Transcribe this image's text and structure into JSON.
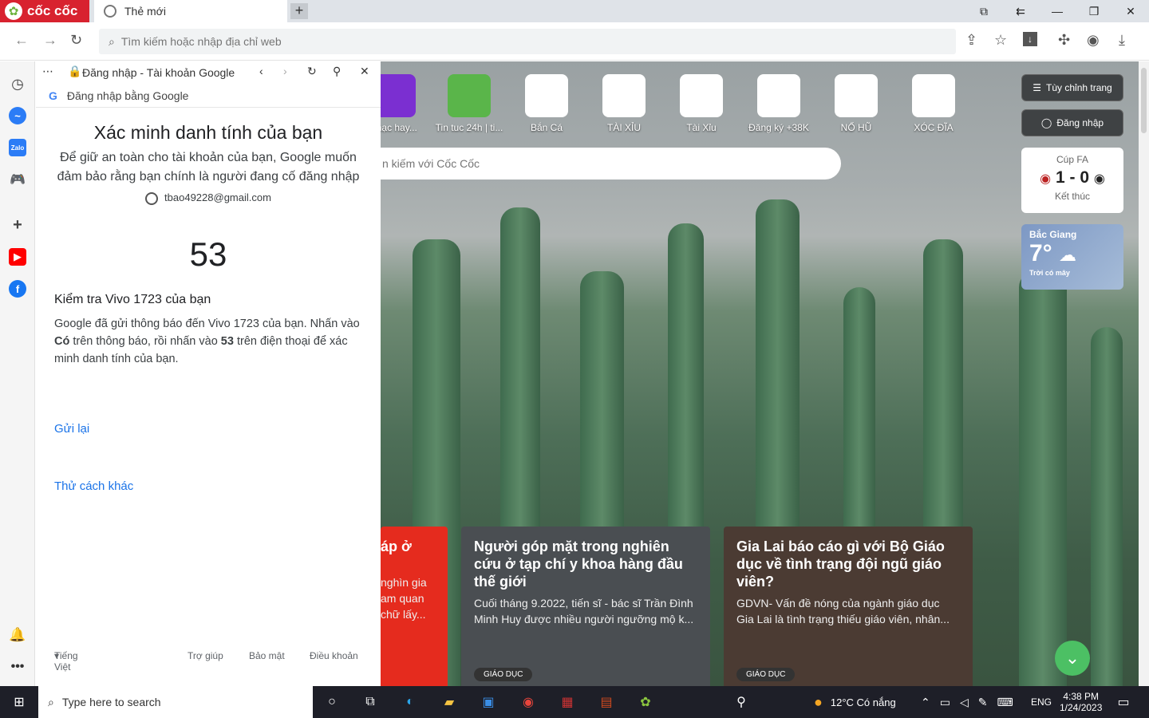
{
  "browser": {
    "brand": "cốc cốc",
    "tab_title": "Thẻ mới",
    "address_placeholder": "Tìm kiếm hoặc nhập địa chỉ web"
  },
  "panel": {
    "page_title": "Đăng nhập - Tài khoản Google",
    "google_line": "Đăng nhập bằng Google",
    "heading": "Xác minh danh tính của bạn",
    "subtitle": "Để giữ an toàn cho tài khoản của bạn, Google muốn đảm bảo rằng bạn chính là người đang cố đăng nhập",
    "email": "tbao49228@gmail.com",
    "code": "53",
    "check_heading": "Kiểm tra Vivo 1723 của bạn",
    "body_1": "Google đã gửi thông báo đến Vivo 1723 của bạn. Nhấn vào ",
    "body_bold_1": "Có",
    "body_2": " trên thông báo, rồi nhấn vào ",
    "body_bold_2": "53",
    "body_3": " trên điện thoại để xác minh danh tính của bạn.",
    "resend": "Gửi lại",
    "try_other": "Thử cách khác",
    "language": "Tiếng Việt",
    "help": "Trợ giúp",
    "privacy": "Bảo mật",
    "terms": "Điều khoản"
  },
  "newtab": {
    "tiles": [
      {
        "label": "nhạc hay..."
      },
      {
        "label": "Tin tuc 24h | ti..."
      },
      {
        "label": "Bắn Cá"
      },
      {
        "label": "TÀI XỈU"
      },
      {
        "label": "Tài Xỉu"
      },
      {
        "label": "Đăng ký +38K"
      },
      {
        "label": "NỔ HŨ"
      },
      {
        "label": "XÓC ĐĨA"
      }
    ],
    "search_placeholder": "n kiếm với Cốc Cốc",
    "customize": "Tùy chỉnh trang",
    "login": "Đăng nhập",
    "score": {
      "league": "Cúp FA",
      "result": "1 - 0",
      "status": "Kết thúc"
    },
    "weather": {
      "city": "Bắc Giang",
      "temp": "7°",
      "desc": "Trời có mây"
    },
    "cards": [
      {
        "title": "áp ở",
        "desc": "nghìn gia\nam quan\nchữ lấy...",
        "color": "#e52b1e"
      },
      {
        "title": "Người góp mặt trong nghiên cứu ở tạp chí y khoa hàng đầu thế giới",
        "desc": "Cuối tháng 9.2022, tiến sĩ - bác sĩ Trần Đình Minh Huy được nhiều người ngưỡng mộ k...",
        "tag": "GIÁO DỤC",
        "color": "#4a4e52"
      },
      {
        "title": "Gia Lai báo cáo gì với Bộ Giáo dục về tình trạng đội ngũ giáo viên?",
        "desc": "GDVN- Vấn đề nóng của ngành giáo dục Gia Lai là tình trạng thiếu giáo viên, nhân...",
        "tag": "GIÁO DỤC",
        "color": "#4b3b33"
      }
    ]
  },
  "taskbar": {
    "search_placeholder": "Type here to search",
    "weather": "12°C  Có nắng",
    "lang": "ENG",
    "time": "4:38 PM",
    "date": "1/24/2023"
  }
}
